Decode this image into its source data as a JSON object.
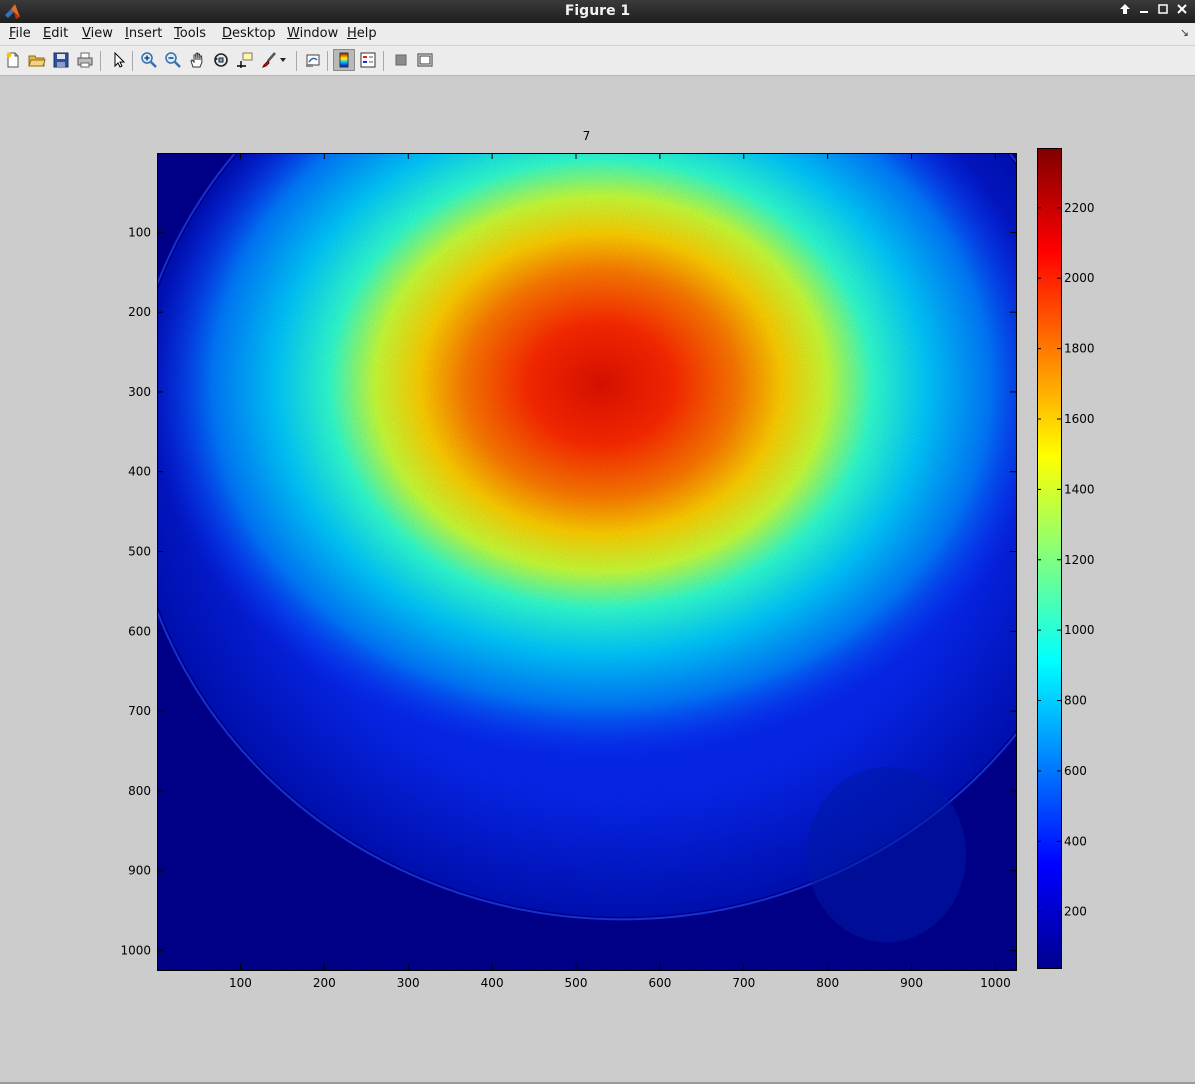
{
  "window": {
    "title": "Figure 1",
    "icon": "matlab-logo-icon",
    "controls": [
      "maximize-arrow-icon",
      "minimize-icon",
      "restore-icon",
      "close-icon"
    ],
    "control_glyphs": [
      "🡡",
      "–",
      "□",
      "✕"
    ]
  },
  "menubar": {
    "items": [
      {
        "label": "File",
        "hotkey": "F",
        "rest": "ile"
      },
      {
        "label": "Edit",
        "hotkey": "E",
        "rest": "dit"
      },
      {
        "label": "View",
        "hotkey": "V",
        "rest": "iew"
      },
      {
        "label": "Insert",
        "hotkey": "I",
        "rest": "nsert"
      },
      {
        "label": "Tools",
        "hotkey": "T",
        "rest": "ools"
      },
      {
        "label": "Desktop",
        "hotkey": "D",
        "rest": "esktop"
      },
      {
        "label": "Window",
        "hotkey": "W",
        "rest": "indow"
      },
      {
        "label": "Help",
        "hotkey": "H",
        "rest": "elp"
      }
    ],
    "dock_arrow": "↘"
  },
  "toolbar": {
    "buttons": [
      "new-figure-icon",
      "open-file-icon",
      "save-icon",
      "print-icon",
      "edit-plot-arrow-icon",
      "zoom-in-icon",
      "zoom-out-icon",
      "pan-hand-icon",
      "rotate-3d-icon",
      "data-cursor-icon",
      "brush-icon",
      "link-plot-icon",
      "colorbar-icon",
      "legend-icon",
      "hide-plot-tools-icon",
      "show-plot-tools-icon"
    ],
    "pressed": "colorbar-icon"
  },
  "chart_data": {
    "type": "heatmap",
    "title": "7",
    "xlabel": "",
    "ylabel": "",
    "colormap": "jet",
    "xlim": [
      0.5,
      1024.5
    ],
    "ylim": [
      0.5,
      1024.5
    ],
    "y_reversed": true,
    "x_ticks": [
      100,
      200,
      300,
      400,
      500,
      600,
      700,
      800,
      900,
      1000
    ],
    "y_ticks": [
      100,
      200,
      300,
      400,
      500,
      600,
      700,
      800,
      900,
      1000
    ],
    "colorbar": {
      "range": [
        40,
        2370
      ],
      "ticks": [
        200,
        400,
        600,
        800,
        1000,
        1200,
        1400,
        1600,
        1800,
        2000,
        2200
      ]
    },
    "features": {
      "peak_center": [
        530,
        290
      ],
      "peak_value": 2250,
      "background_value": 80,
      "disc_center": [
        555,
        370
      ],
      "disc_radius": 600
    }
  }
}
